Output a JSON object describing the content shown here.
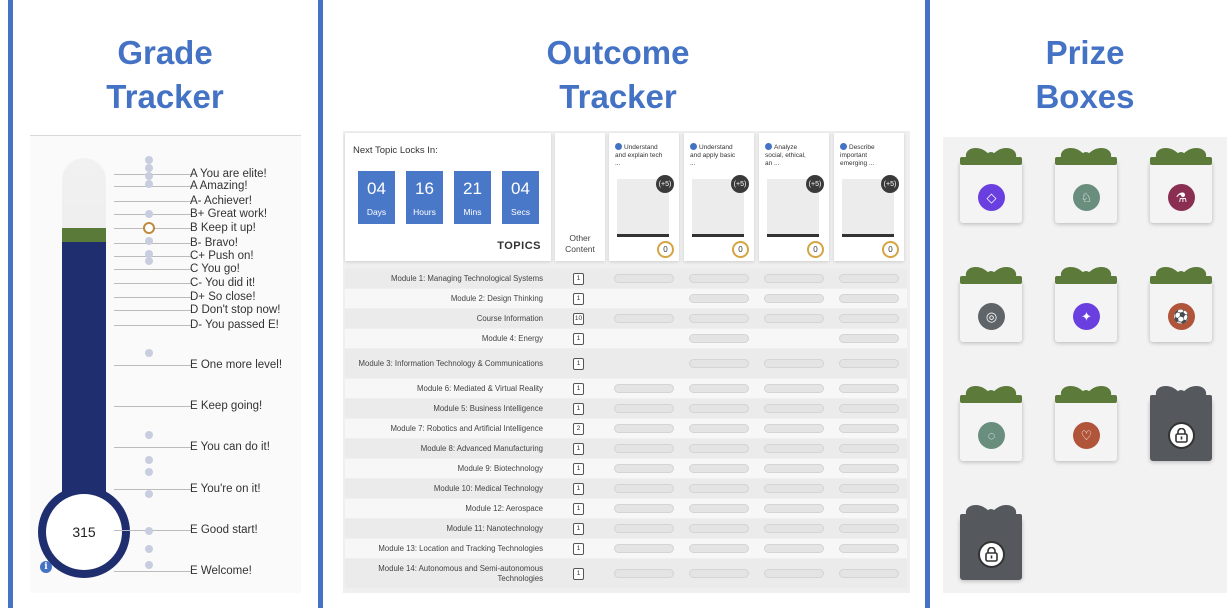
{
  "headings": {
    "grade": [
      "Grade",
      "Tracker"
    ],
    "outcome": [
      "Outcome",
      "Tracker"
    ],
    "prize": [
      "Prize",
      "Boxes"
    ]
  },
  "grade_tracker": {
    "score": "315",
    "info_icon": "info-icon",
    "levels": [
      "A You are elite!",
      "A Amazing!",
      "A- Achiever!",
      "B+ Great work!",
      "B Keep it up!",
      "B- Bravo!",
      "C+ Push on!",
      "C You go!",
      "C- You did it!",
      "D+ So close!",
      "D Don't stop now!",
      "D- You passed E!",
      "E One more level!",
      "E Keep going!",
      "E You can do it!",
      "E You're on it!",
      "E Good start!",
      "E Welcome!"
    ],
    "colors": {
      "fill": "#1f2e6e",
      "level_band": "#5a7a3a",
      "marker": "#c08a3e"
    }
  },
  "outcome_tracker": {
    "lock_label": "Next Topic Locks In:",
    "countdown": [
      {
        "value": "04",
        "unit": "Days"
      },
      {
        "value": "16",
        "unit": "Hours"
      },
      {
        "value": "21",
        "unit": "Mins"
      },
      {
        "value": "04",
        "unit": "Secs"
      }
    ],
    "topics_label": "TOPICS",
    "other_content_label": [
      "Other",
      "Content"
    ],
    "outcomes": [
      {
        "lines": [
          "Understand",
          "and explain tech",
          "..."
        ],
        "bonus": "(+5)",
        "score": "0"
      },
      {
        "lines": [
          "Understand",
          "and apply basic",
          "..."
        ],
        "bonus": "(+5)",
        "score": "0"
      },
      {
        "lines": [
          "Analyze",
          "social, ethical,",
          "an ..."
        ],
        "bonus": "(+5)",
        "score": "0"
      },
      {
        "lines": [
          "Describe",
          "important",
          "emerging ..."
        ],
        "bonus": "(+5)",
        "score": "0"
      }
    ],
    "modules": [
      {
        "name": "Module 1: Managing Technological Systems",
        "count": "1",
        "pills": [
          1,
          1,
          1,
          1
        ]
      },
      {
        "name": "Module 2: Design Thinking",
        "count": "1",
        "pills": [
          0,
          1,
          1,
          1
        ]
      },
      {
        "name": "Course Information",
        "count": "10",
        "pills": [
          1,
          1,
          1,
          1
        ]
      },
      {
        "name": "Module 4: Energy",
        "count": "1",
        "pills": [
          0,
          1,
          0,
          1
        ]
      },
      {
        "name": "Module 3: Information Technology & Communications",
        "count": "1",
        "pills": [
          0,
          1,
          1,
          1
        ]
      },
      {
        "name": "Module 6: Mediated & Virtual Reality",
        "count": "1",
        "pills": [
          1,
          1,
          1,
          1
        ]
      },
      {
        "name": "Module 5: Business Intelligence",
        "count": "1",
        "pills": [
          1,
          1,
          1,
          1
        ]
      },
      {
        "name": "Module 7: Robotics and Artificial Intelligence",
        "count": "2",
        "pills": [
          1,
          1,
          1,
          1
        ]
      },
      {
        "name": "Module 8: Advanced Manufacturing",
        "count": "1",
        "pills": [
          1,
          1,
          1,
          1
        ]
      },
      {
        "name": "Module 9: Biotechnology",
        "count": "1",
        "pills": [
          1,
          1,
          1,
          1
        ]
      },
      {
        "name": "Module 10: Medical Technology",
        "count": "1",
        "pills": [
          1,
          1,
          1,
          1
        ]
      },
      {
        "name": "Module 12: Aerospace",
        "count": "1",
        "pills": [
          1,
          1,
          1,
          1
        ]
      },
      {
        "name": "Module 11: Nanotechnology",
        "count": "1",
        "pills": [
          1,
          1,
          1,
          1
        ]
      },
      {
        "name": "Module 13: Location and Tracking Technologies",
        "count": "1",
        "pills": [
          1,
          1,
          1,
          1
        ]
      },
      {
        "name": "Module 14: Autonomous and Semi-autonomous Technologies",
        "count": "1",
        "pills": [
          1,
          1,
          1,
          1
        ]
      }
    ],
    "colors": {
      "countdown": "#4a78c8",
      "score_ring": "#d5a545"
    }
  },
  "prize_boxes": {
    "bow_color": "#5c7a3a",
    "bow_color_locked": "#55595e",
    "boxes": [
      {
        "icon": "gem-icon",
        "glyph": "◇",
        "color": "#6a3fe0",
        "locked": false
      },
      {
        "icon": "rocking-horse-icon",
        "glyph": "♘",
        "color": "#6a8e7e",
        "locked": false
      },
      {
        "icon": "flask-icon",
        "glyph": "⚗",
        "color": "#8a2f52",
        "locked": false
      },
      {
        "icon": "target-icon",
        "glyph": "◎",
        "color": "#5f6469",
        "locked": false
      },
      {
        "icon": "telescope-icon",
        "glyph": "✦",
        "color": "#6a3fe0",
        "locked": false
      },
      {
        "icon": "soccer-ball-icon",
        "glyph": "⚽",
        "color": "#b0543a",
        "locked": false
      },
      {
        "icon": "ring-icon",
        "glyph": "◌",
        "color": "#6a8e7e",
        "locked": false
      },
      {
        "icon": "heart-icon",
        "glyph": "♡",
        "color": "#b0543a",
        "locked": false
      },
      {
        "icon": "lock-icon",
        "glyph": "🔒",
        "color": "#ffffff",
        "locked": true
      },
      {
        "icon": "lock-icon",
        "glyph": "🔒",
        "color": "#ffffff",
        "locked": true
      }
    ]
  }
}
